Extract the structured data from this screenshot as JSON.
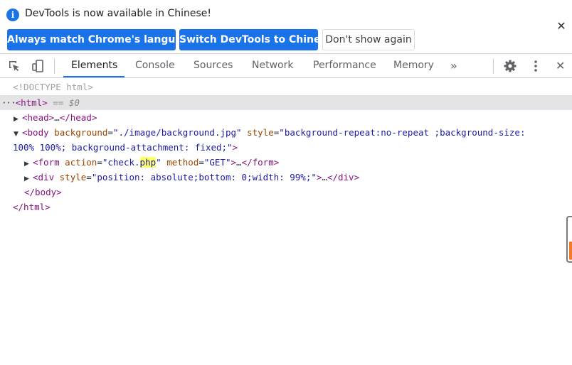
{
  "infobar": {
    "message": "DevTools is now available in Chinese!",
    "info_icon": "info-icon",
    "close_glyph": "✕",
    "buttons": {
      "match_language": "Always match Chrome's language",
      "switch_language": "Switch DevTools to Chinese",
      "dont_show": "Don't show again"
    }
  },
  "toolbar": {
    "icons": {
      "inspect": "inspect-element-icon",
      "device": "device-toolbar-icon",
      "more_tabs": "»",
      "settings": "gear-icon",
      "menu": "kebab-menu-icon",
      "close": "✕"
    },
    "tabs": [
      {
        "label": "Elements",
        "active": true
      },
      {
        "label": "Console",
        "active": false
      },
      {
        "label": "Sources",
        "active": false
      },
      {
        "label": "Network",
        "active": false
      },
      {
        "label": "Performance",
        "active": false
      },
      {
        "label": "Memory",
        "active": false
      }
    ]
  },
  "dom": {
    "doctype": "<!DOCTYPE html>",
    "html_open": "<html>",
    "selected_marker": "== $0",
    "head": {
      "open": "<head>",
      "ellipsis": "…",
      "close": "</head>"
    },
    "body": {
      "open_tag": "<body",
      "attr1_name": "background",
      "attr1_value": "\"./image/background.jpg\"",
      "attr2_name": "style",
      "attr2_value_part1": "\"background-repeat:no-repeat ;background-size:",
      "attr2_value_part2": "100% 100%; background-attachment: fixed;\"",
      "open_end": ">",
      "close": "</body>"
    },
    "form": {
      "open_tag": "<form",
      "attr1_name": "action",
      "attr1_value_start": "\"check.",
      "attr1_value_highlight": "php",
      "attr1_value_end": "\"",
      "attr2_name": "method",
      "attr2_value": "\"GET\"",
      "open_end": ">",
      "ellipsis": "…",
      "close": "</form>"
    },
    "div": {
      "open_tag": "<div",
      "attr1_name": "style",
      "attr1_value": "\"position: absolute;bottom: 0;width: 99%;\"",
      "open_end": ">",
      "ellipsis": "…",
      "close": "</div>"
    },
    "html_close": "</html>"
  },
  "colors": {
    "accent": "#1a73e8",
    "tag": "#881280",
    "attribute": "#994500",
    "value": "#1a1aa6",
    "search_highlight": "#ffff66"
  }
}
